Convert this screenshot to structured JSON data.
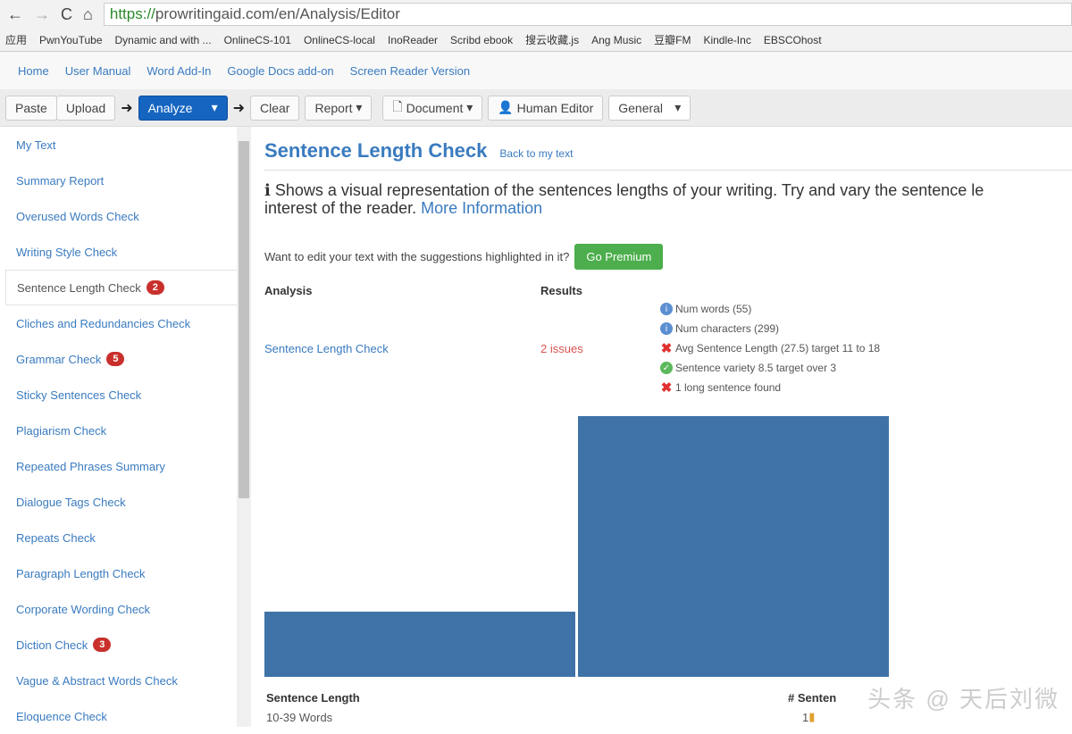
{
  "browser": {
    "url_scheme": "https://",
    "url_rest": "prowritingaid.com/en/Analysis/Editor",
    "bookmarks": [
      "应用",
      "PwnYouTube",
      "Dynamic and with ...",
      "OnlineCS-101",
      "OnlineCS-local",
      "InoReader",
      "Scribd ebook",
      "搜云收藏.js",
      "Ang Music",
      "豆瓣FM",
      "Kindle-Inc",
      "EBSCOhost"
    ]
  },
  "topnav": [
    "Home",
    "User Manual",
    "Word Add-In",
    "Google Docs add-on",
    "Screen Reader Version"
  ],
  "toolbar": {
    "paste": "Paste",
    "upload": "Upload",
    "analyze": "Analyze",
    "clear": "Clear",
    "report": "Report",
    "document": "Document",
    "human_editor": "Human Editor",
    "general": "General"
  },
  "sidebar": [
    {
      "label": "My Text"
    },
    {
      "label": "Summary Report"
    },
    {
      "label": "Overused Words Check"
    },
    {
      "label": "Writing Style Check"
    },
    {
      "label": "Sentence Length Check",
      "badge": "2",
      "active": true
    },
    {
      "label": "Cliches and Redundancies Check"
    },
    {
      "label": "Grammar Check",
      "badge": "5"
    },
    {
      "label": "Sticky Sentences Check"
    },
    {
      "label": "Plagiarism Check"
    },
    {
      "label": "Repeated Phrases Summary"
    },
    {
      "label": "Dialogue Tags Check"
    },
    {
      "label": "Repeats Check"
    },
    {
      "label": "Paragraph Length Check"
    },
    {
      "label": "Corporate Wording Check"
    },
    {
      "label": "Diction Check",
      "badge": "3"
    },
    {
      "label": "Vague & Abstract Words Check"
    },
    {
      "label": "Eloquence Check"
    }
  ],
  "main": {
    "title": "Sentence Length Check",
    "back": "Back to my text",
    "desc1": "Shows a visual representation of the sentences lengths of your writing. Try and vary the sentence le",
    "desc2": "interest of the reader.",
    "more": "More Information",
    "premium_q": "Want to edit your text with the suggestions highlighted in it?",
    "premium_btn": "Go Premium",
    "col_analysis": "Analysis",
    "col_results": "Results",
    "analysis_name": "Sentence Length Check",
    "issues": "2 issues",
    "results": [
      {
        "icon": "info",
        "text": "Num words (55)"
      },
      {
        "icon": "info",
        "text": "Num characters (299)"
      },
      {
        "icon": "error",
        "text": "Avg Sentence Length (27.5) target 11 to 18"
      },
      {
        "icon": "ok",
        "text": "Sentence variety 8.5 target over 3"
      },
      {
        "icon": "error",
        "text": "1 long sentence found"
      }
    ],
    "len_col": "Sentence Length",
    "count_col": "# Senten",
    "len_row": "10-39 Words",
    "count_row": "1"
  },
  "chart_data": {
    "type": "bar",
    "values": [
      11,
      44
    ],
    "color": "#3f73a8",
    "title": "",
    "xlabel": "",
    "ylabel": ""
  },
  "watermark": "头条 @ 天后刘微"
}
